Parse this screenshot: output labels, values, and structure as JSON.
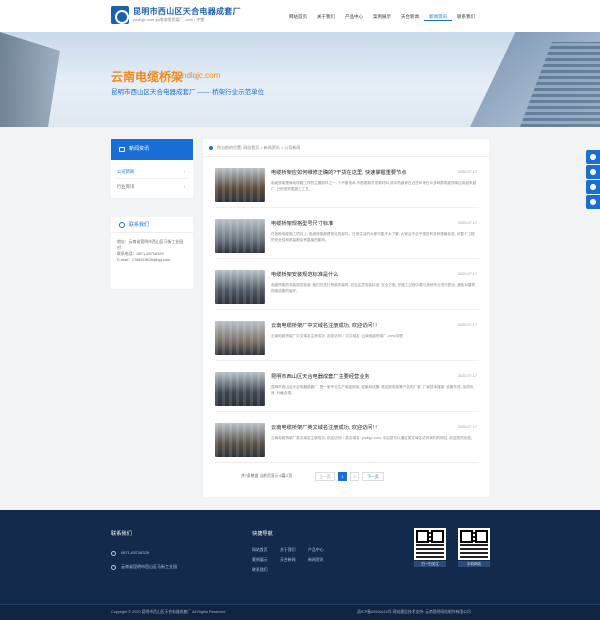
{
  "header": {
    "logo_title": "昆明市西山区天合电器成套厂",
    "logo_sub": "yndlqjc.com  云南电缆桥架厂 .com / 冲塑",
    "nav": [
      "网站首页",
      "关于我们",
      "产品中心",
      "案例展示",
      "天合新闻",
      "新闻资讯",
      "联系我们"
    ]
  },
  "banner": {
    "title": "云南电缆桥架",
    "url": "yndlqjc.com",
    "subtitle": "昆明市西山区天合电器成套厂 —— 桥架行业示范单位"
  },
  "sidebar": {
    "head": "新闻资讯",
    "items": [
      {
        "label": "公司新闻"
      },
      {
        "label": "行业资讯"
      }
    ],
    "contact": {
      "head": "联系我们",
      "address": "地址：云南省昆明市西山区马街工业园",
      "address2": "村",
      "phone": "联系电话：0871-65716329",
      "email": "E-mail：1768219026@qq.com"
    }
  },
  "main": {
    "breadcrumb": "你当前的位置:  网站首页 >  新闻资讯 >  公司新闻",
    "articles": [
      {
        "title": "电缆桥架应如何维修正确的?干货在这里, 快速掌握重要节点",
        "date": "2020.07.17",
        "desc": "电缆桥架是输电线路工作的主要部件之一, 个不断技术,不断更新开发新材料,其中热镀锌在近些年来在众多种类电缆桥架应用越来越广, 已形成完善施工工艺。",
        "tone": "#5b4a3a"
      },
      {
        "title": "电缆桥架规格型号尺寸标准",
        "date": "2020.07.17",
        "desc": "在各种电缆施工项目上, 电缆桥架都是常见的部件。日常生活的大家可能不太了解, 大家合不合乎规范有多种规格标准, 对整个工程的安全性和质量都会有直接的影响。",
        "tone": "#6c7480"
      },
      {
        "title": "电缆桥架安装规范标准是什么",
        "date": "2020.07.17",
        "desc": "电缆桥架的安装规范标准: 我们在进行桥架安装时, 应当注意安装标准, 安全方面, 在施工过程中要与其他专业进行配合, 避免对建筑物或设备的破坏。",
        "tone": "#4e5662"
      },
      {
        "title": "云南电缆桥架厂中文域名注册成功, 欢迎访问! !",
        "date": "2020.07.17",
        "desc": "云南电缆桥架厂中文域名注册成功, 欢迎访问! ! 中文域名: 云南电缆桥架厂.com/冲塑",
        "tone": "#7a7268"
      },
      {
        "title": "昆明市西山区天合电器成套厂主要经营业务",
        "date": "2020.07.17",
        "desc": "昆明市西山区天合电器成套厂, 是一家专业生产电缆桥架, 密集母线槽, 低压配电柜等产品的厂家, 厂家技术雄厚, 设备先进, 品质优良, 价格合理。",
        "tone": "#3f4650"
      },
      {
        "title": "云南电缆桥架厂英文域名注册成功, 欢迎访问! !",
        "date": "2020.07.17",
        "desc": "云南电缆桥架厂英文域名注册成功, 欢迎访问! ! 英文域名: yndlqjc.com, 今后您可以通过英文域名访问我们的网站, 欢迎您的光临。",
        "tone": "#5a5248"
      }
    ],
    "pager": {
      "info": "共7条数据 当前页显示 6篇/2页",
      "first": "上一页",
      "pages": [
        "1",
        "2"
      ],
      "next": "下一页"
    }
  },
  "footer": {
    "contact_head": "联系我们",
    "phone": "0871-65716329",
    "address": "云南省昆明市西山区马街工业园",
    "links_head": "快捷导航",
    "links": [
      "网站首页",
      "关于我们",
      "产品中心",
      "案例展示",
      "天合新闻",
      "新闻资讯",
      "联系我们"
    ],
    "qr1_caption": "扫一扫关注",
    "qr2_caption": "手机网站",
    "copyright": "Copyright © 2020 昆明市西山区天合电器成套厂 All Rights Reserved",
    "icp": "滇ICP备20006416号   网站建设技术支持: 云南昆明网站制作有限公司"
  },
  "colors": {
    "brand": "#1a6fd6",
    "accent": "#f08a1c",
    "footer": "#142a4d"
  }
}
